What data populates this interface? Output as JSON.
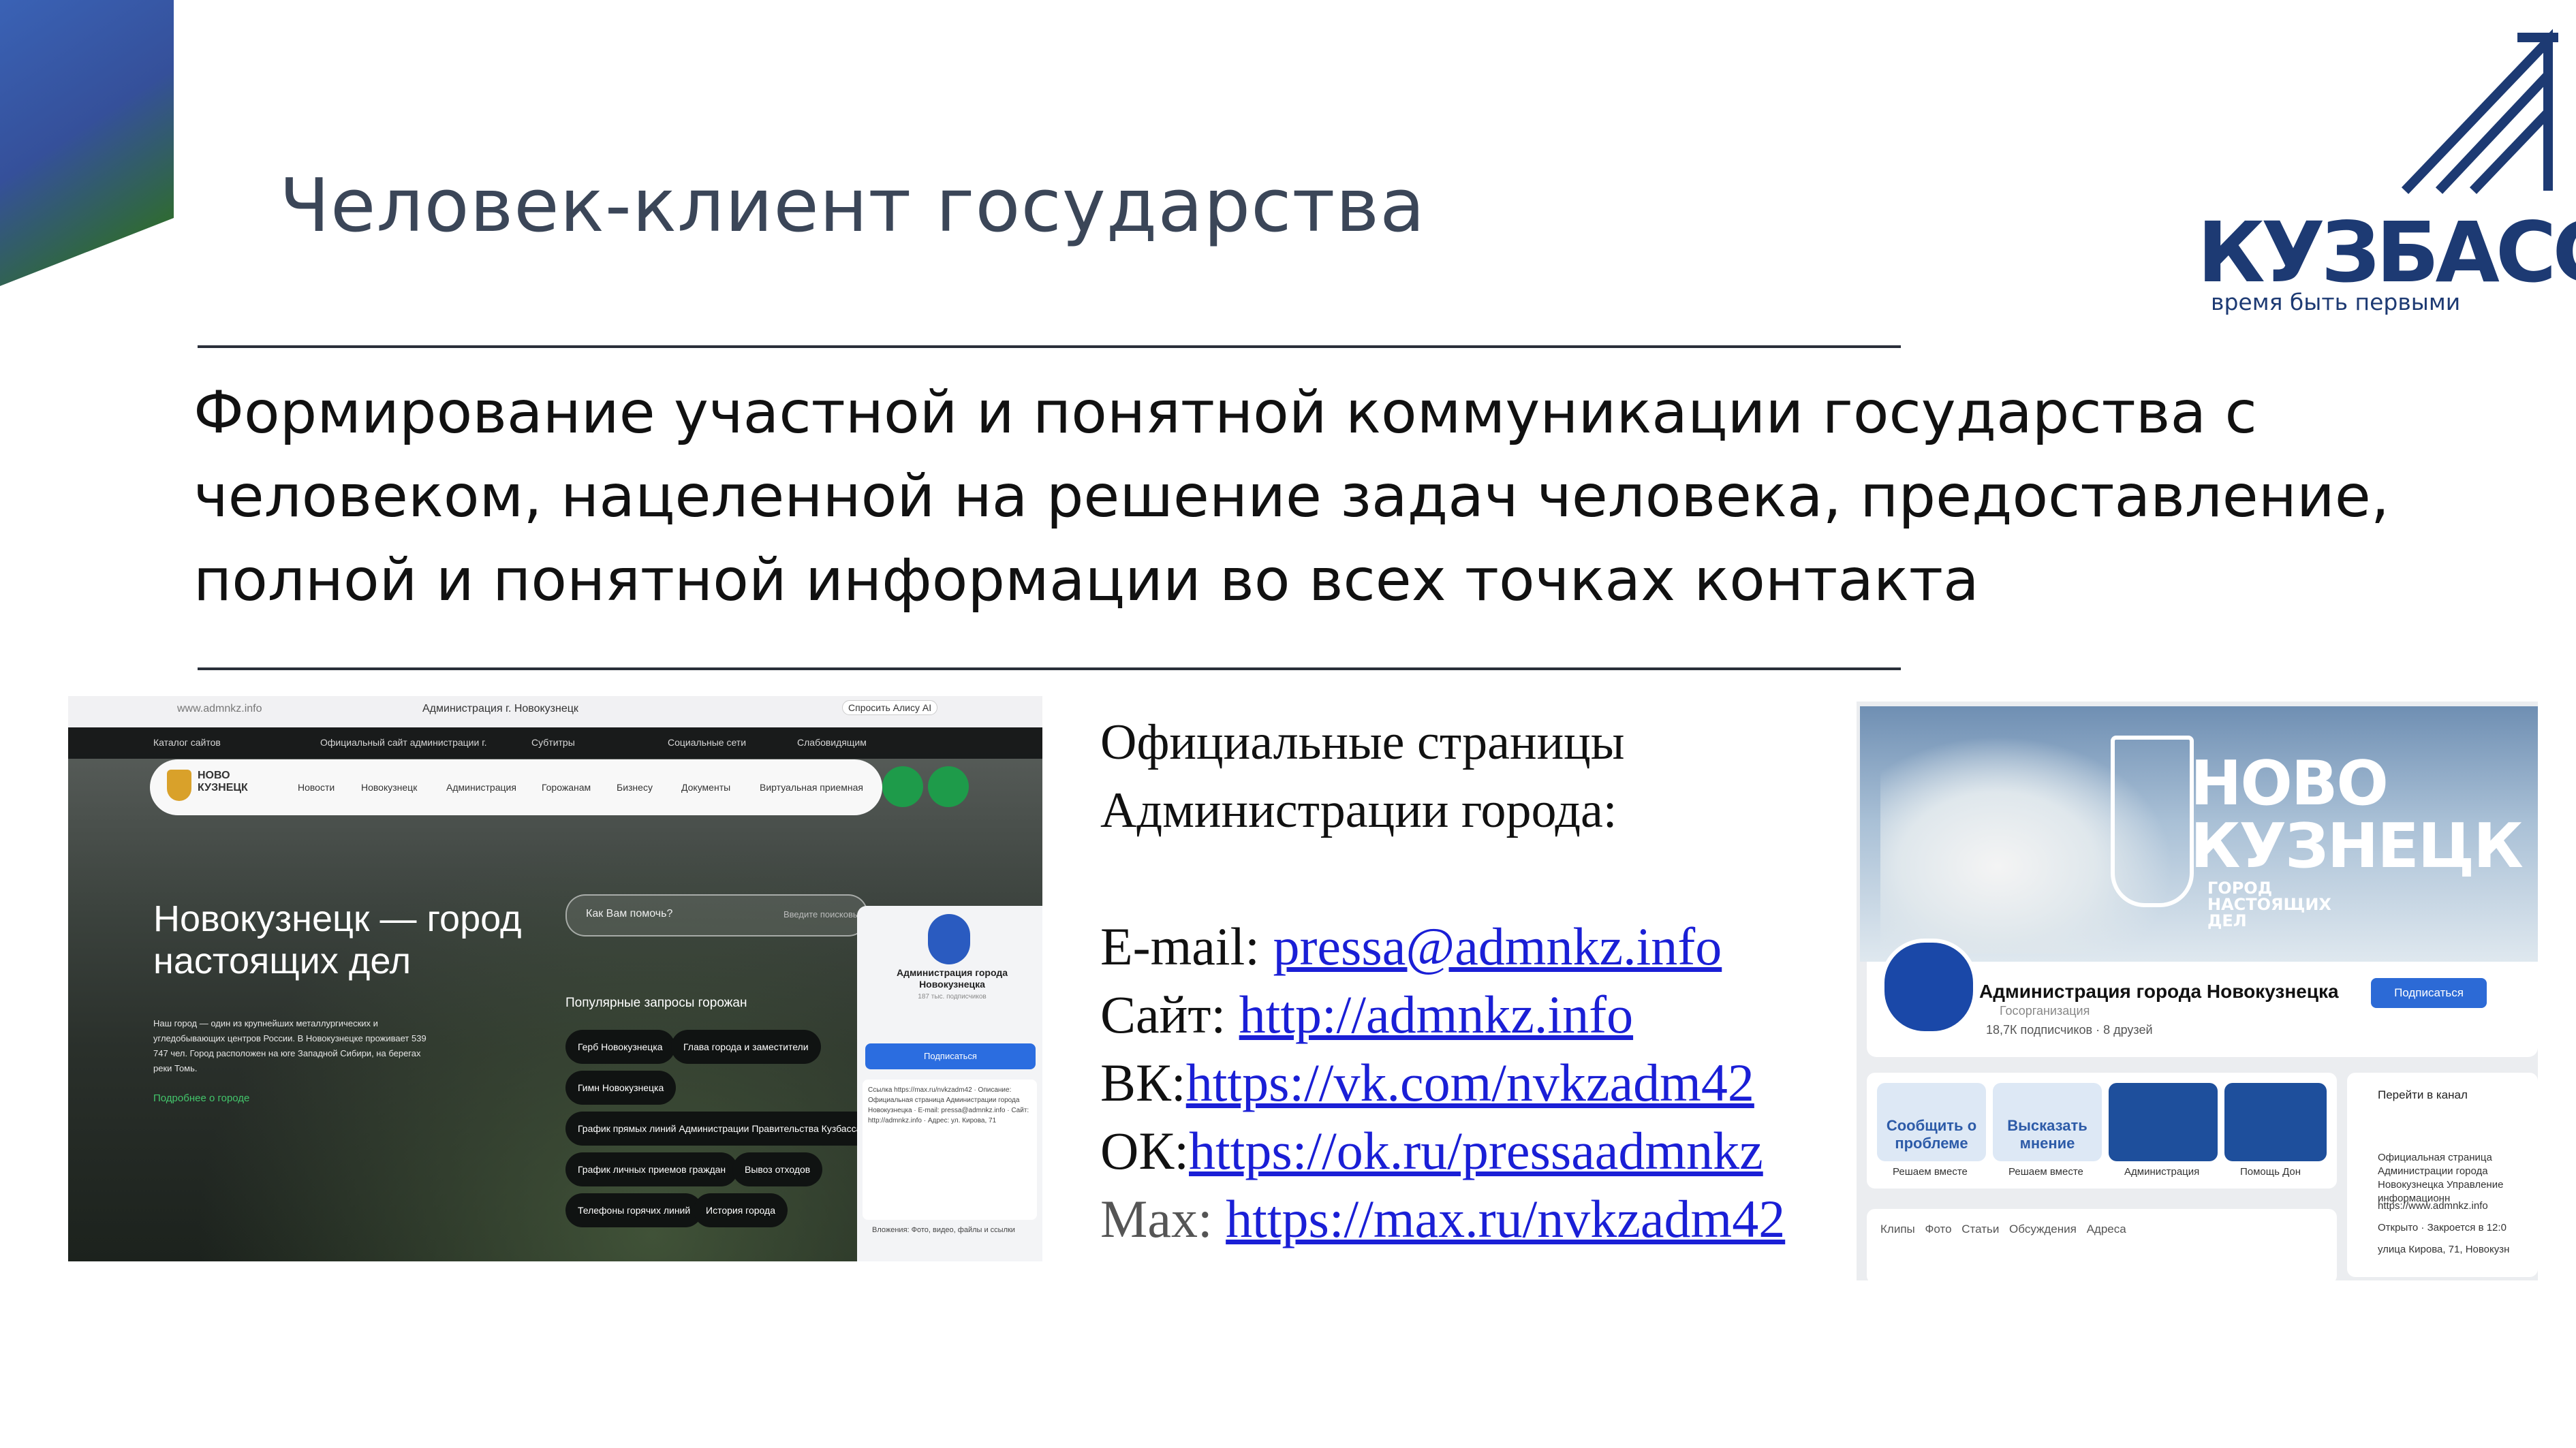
{
  "slide": {
    "title": "Человек-клиент государства",
    "lead": "Формирование участной и понятной коммуникации государства с человеком, нацеленной на решение задач человека, предоставление, полной и понятной информации во всех точках контакта",
    "logo": {
      "word": "КУЗБАСС",
      "slogan": "время быть первыми"
    },
    "colors": {
      "title": "#3b4658",
      "brand": "#1d3a73",
      "link": "#1a1fd6",
      "accent_blue": "#3560b0",
      "accent_green": "#2e6b2f"
    }
  },
  "contacts": {
    "heading_line1": "Официальные страницы",
    "heading_line2": "Администрации города:",
    "email_label": "E-mail: ",
    "email": "pressa@admnkz.info",
    "site_label": "Сайт: ",
    "site": "http://admnkz.info",
    "vk_label": "ВК:",
    "vk": "https://vk.com/nvkzadm42",
    "ok_label": "ОК:",
    "ok": "https://ok.ru/pressaadmnkz",
    "max_label": "Max: ",
    "max": "https://max.ru/nvkzadm42"
  },
  "site_shot": {
    "url": "www.admnkz.info",
    "tab_title": "Администрация г. Новокузнецк",
    "alice": "Спросить Алису AI",
    "top_links": [
      "Каталог сайтов",
      "Официальный сайт администрации г.",
      "Субтитры",
      "Социальные сети",
      "Слабовидящим"
    ],
    "logo_line1": "НОВО",
    "logo_line2": "КУЗНЕЦК",
    "nav": [
      "Новости",
      "Новокузнецк",
      "Администрация",
      "Горожанам",
      "Бизнесу",
      "Документы",
      "Виртуальная приемная"
    ],
    "hero_line1": "Новокузнецк — город",
    "hero_line2": "настоящих дел",
    "description": "Наш город — один из крупнейших металлургических и угледобывающих центров России. В Новокузнецке проживает 539 747 чел. Город расположен на юге Западной Сибири, на берегах реки Томь.",
    "more": "Подробнее о городе",
    "search_label": "Как Вам помочь?",
    "search_hint": "Введите поисковый",
    "popular": "Популярные запросы горожан",
    "chips": [
      "Герб Новокузнецка",
      "Глава города и заместители",
      "Гимн Новокузнецка",
      "График прямых линий Администрации Правительства Кузбасса",
      "График личных приемов граждан",
      "Вывоз отходов",
      "Телефоны горячих линий",
      "История города"
    ],
    "phone": {
      "name": "Администрация города Новокузнецка",
      "sub": "187 тыс. подписчиков",
      "subscribe": "Подписаться",
      "card": "Ссылка https://max.ru/nvkzadm42 · Описание: Официальная страница Администрации города Новокузнецка · E-mail: pressa@admnkz.info · Сайт: http://admnkz.info · Адрес: ул. Кирова, 71",
      "footer": "Вложения: Фото, видео, файлы и ссылки"
    }
  },
  "vk_shot": {
    "brand_line1": "НОВО",
    "brand_line2": "КУЗНЕЦК",
    "brand_sub": "ГОРОД НАСТОЯЩИХ ДЕЛ",
    "name": "Администрация города Новокузнецка",
    "org": "Госорганизация",
    "subscribers": "18,7К подписчиков · 8 друзей",
    "subscribe": "Подписаться",
    "tiles": [
      {
        "text": "Сообщить о проблеме",
        "label": "Решаем вместе"
      },
      {
        "text": "Высказать мнение",
        "label": "Решаем вместе"
      },
      {
        "text": "",
        "label": "Администрация"
      },
      {
        "text": "",
        "label": "Помощь Дон"
      }
    ],
    "goto": "Перейти в канал",
    "side_text": "Официальная страница Администрации города Новокузнецка Управление информационн",
    "side_web": "https://www.admnkz.info",
    "side_open": "Открыто · Закроется в 12:0",
    "side_addr": "улица Кирова, 71, Новокузн",
    "tabs": "Клипы  Фото  Статьи  Обсуждения  Адреса"
  }
}
